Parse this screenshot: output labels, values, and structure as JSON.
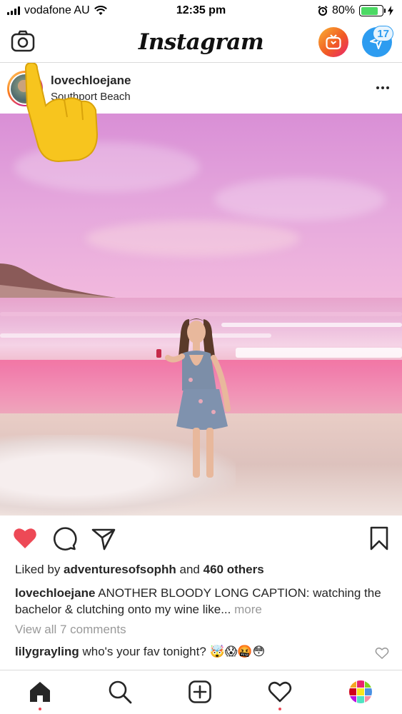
{
  "status_bar": {
    "carrier": "vodafone AU",
    "time": "12:35 pm",
    "battery_percent": "80%",
    "battery_level": 0.8
  },
  "header": {
    "logo": "Instagram",
    "dm_badge_count": "17"
  },
  "post": {
    "username": "lovechloejane",
    "location": "Southport Beach",
    "liked_text": {
      "prefix": "Liked by ",
      "user": "adventuresofsophh",
      "middle": " and ",
      "others": "460 others"
    },
    "caption": {
      "user": "lovechloejane",
      "text": " ANOTHER BLOODY LONG CAPTION: watching the bachelor & clutching onto my wine like... ",
      "more": "more"
    },
    "view_comments": "View all 7 comments",
    "comment": {
      "user": "lilygrayling",
      "text": " who's your fav tonight? 🤯😱🤬😳"
    },
    "liked": true
  },
  "icons": {
    "camera": "camera-icon",
    "igtv": "igtv-icon",
    "direct": "direct-message-icon",
    "more": "more-options-icon",
    "like": "heart-icon",
    "comment": "comment-icon",
    "share": "share-icon",
    "save": "bookmark-icon",
    "home": "home-icon",
    "search": "search-icon",
    "new_post": "new-post-icon",
    "activity": "activity-icon",
    "profile": "profile-icon"
  },
  "colors": {
    "like_red": "#ed4956",
    "dm_blue": "#2d9cf0",
    "muted_text": "#999999",
    "text": "#262626"
  }
}
